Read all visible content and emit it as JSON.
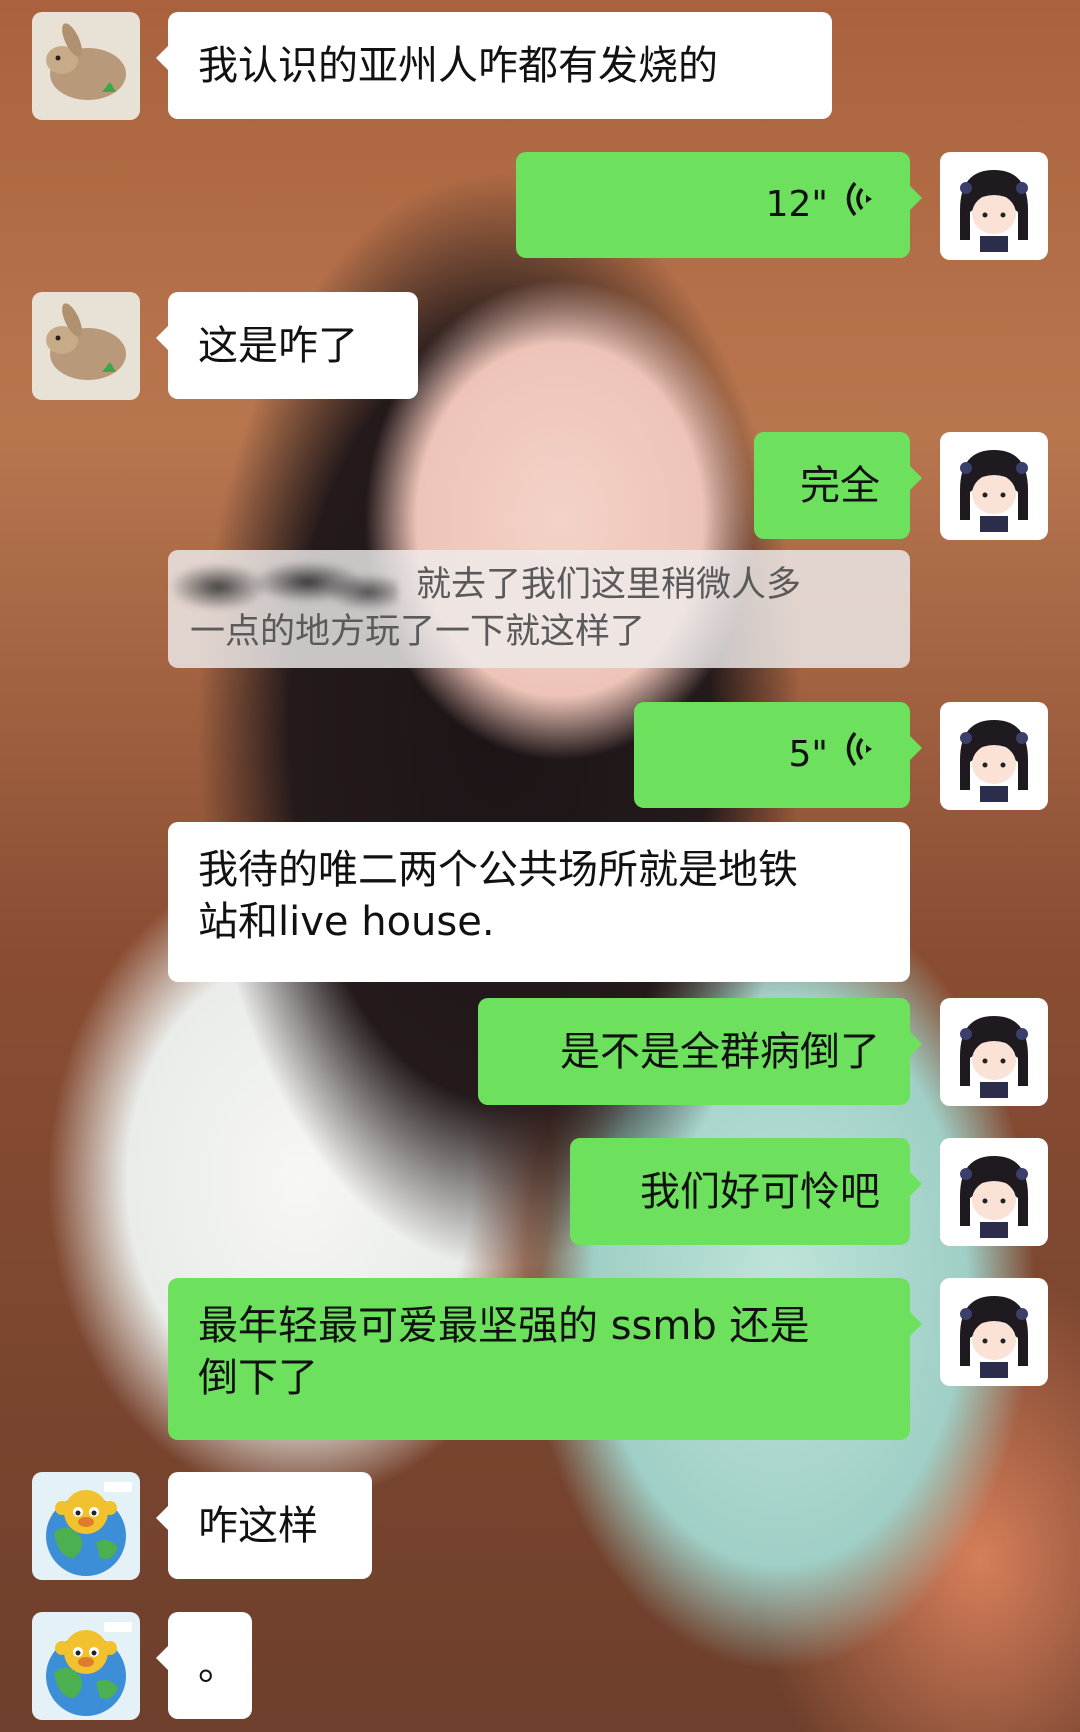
{
  "chat": {
    "messages": [
      {
        "side": "in",
        "sender": "rabbit",
        "text": "我认识的亚州人咋都有发烧的"
      },
      {
        "side": "out",
        "type": "voice",
        "duration": "12\""
      },
      {
        "side": "in",
        "sender": "rabbit",
        "text": "这是咋了"
      },
      {
        "side": "out",
        "text": "完全"
      },
      {
        "type": "system",
        "text_a": "就去了我们这里稍微人多",
        "text_b": "一点的地方玩了一下就这样了"
      },
      {
        "side": "out",
        "type": "voice",
        "duration": "5\""
      },
      {
        "side": "in",
        "line1": "我待的唯二两个公共场所就是地铁",
        "line2": "站和live house."
      },
      {
        "side": "out",
        "text": "是不是全群病倒了"
      },
      {
        "side": "out",
        "text": "我们好可怜吧"
      },
      {
        "side": "out",
        "line1": "最年轻最可爱最坚强的 ssmb 还是",
        "line2": "倒下了"
      },
      {
        "side": "in",
        "sender": "monkey-globe",
        "text": "咋这样"
      },
      {
        "side": "in",
        "sender": "monkey-globe",
        "text": "。"
      }
    ]
  },
  "colors": {
    "outgoing_bubble": "#6de15e",
    "incoming_bubble": "#ffffff",
    "system_bubble": "#eeecec"
  },
  "icons": {
    "voice": "voice-wave-icon",
    "avatar_rabbit": "rabbit-avatar",
    "avatar_self": "anime-girl-avatar",
    "avatar_monkey": "monkey-globe-avatar"
  }
}
